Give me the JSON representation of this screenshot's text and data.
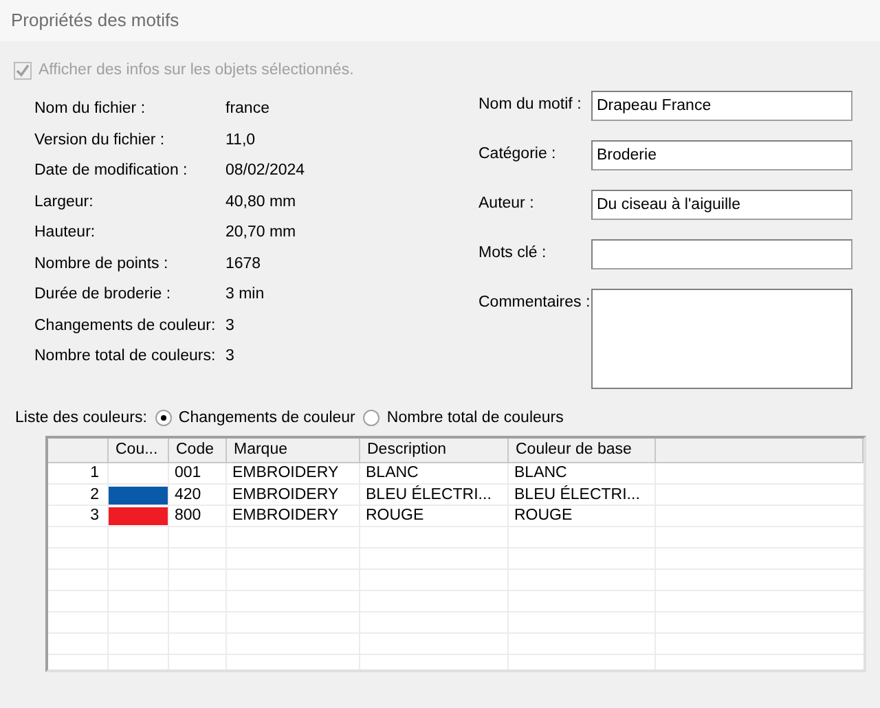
{
  "window": {
    "title": "Propriétés des motifs"
  },
  "show_info": {
    "label": "Afficher des infos sur les objets sélectionnés.",
    "checked": true,
    "disabled": true
  },
  "info": [
    {
      "label": "Nom du fichier :",
      "value": "france"
    },
    {
      "label": "Version du fichier :",
      "value": "11,0"
    },
    {
      "label": "Date de modification :",
      "value": "08/02/2024"
    },
    {
      "label": "Largeur:",
      "value": "40,80 mm"
    },
    {
      "label": "Hauteur:",
      "value": "20,70 mm"
    },
    {
      "label": "Nombre de points :",
      "value": "1678"
    },
    {
      "label": "Durée de broderie :",
      "value": "3 min"
    },
    {
      "label": "Changements de couleur:",
      "value": "3"
    },
    {
      "label": "Nombre total de couleurs:",
      "value": "3"
    }
  ],
  "fields": [
    {
      "label": "Nom du motif :",
      "value": "Drapeau France",
      "kind": "line"
    },
    {
      "label": "Catégorie :",
      "value": "Broderie",
      "kind": "line"
    },
    {
      "label": "Auteur :",
      "value": "Du ciseau à l'aiguille",
      "kind": "line"
    },
    {
      "label": "Mots clé :",
      "kind": "line"
    },
    {
      "label": "Commentaires :",
      "kind": "area"
    }
  ],
  "color_list": {
    "label": "Liste des couleurs:",
    "options": [
      {
        "label": "Changements de couleur",
        "selected": true
      },
      {
        "label": "Nombre total de couleurs",
        "selected": false
      }
    ]
  },
  "table": {
    "columns": [
      "Cou...",
      "Code",
      "Marque",
      "Description",
      "Couleur de base"
    ],
    "rows": [
      {
        "index": "1",
        "code": "001",
        "brand": "EMBROIDERY",
        "description": "BLANC",
        "base": "BLANC"
      },
      {
        "index": "2",
        "color": "#0a5aaa",
        "code": "420",
        "brand": "EMBROIDERY",
        "description": "BLEU ÉLECTRI...",
        "base": "BLEU ÉLECTRI..."
      },
      {
        "index": "3",
        "color": "#ee1c25",
        "code": "800",
        "brand": "EMBROIDERY",
        "description": "ROUGE",
        "base": "ROUGE"
      }
    ]
  }
}
